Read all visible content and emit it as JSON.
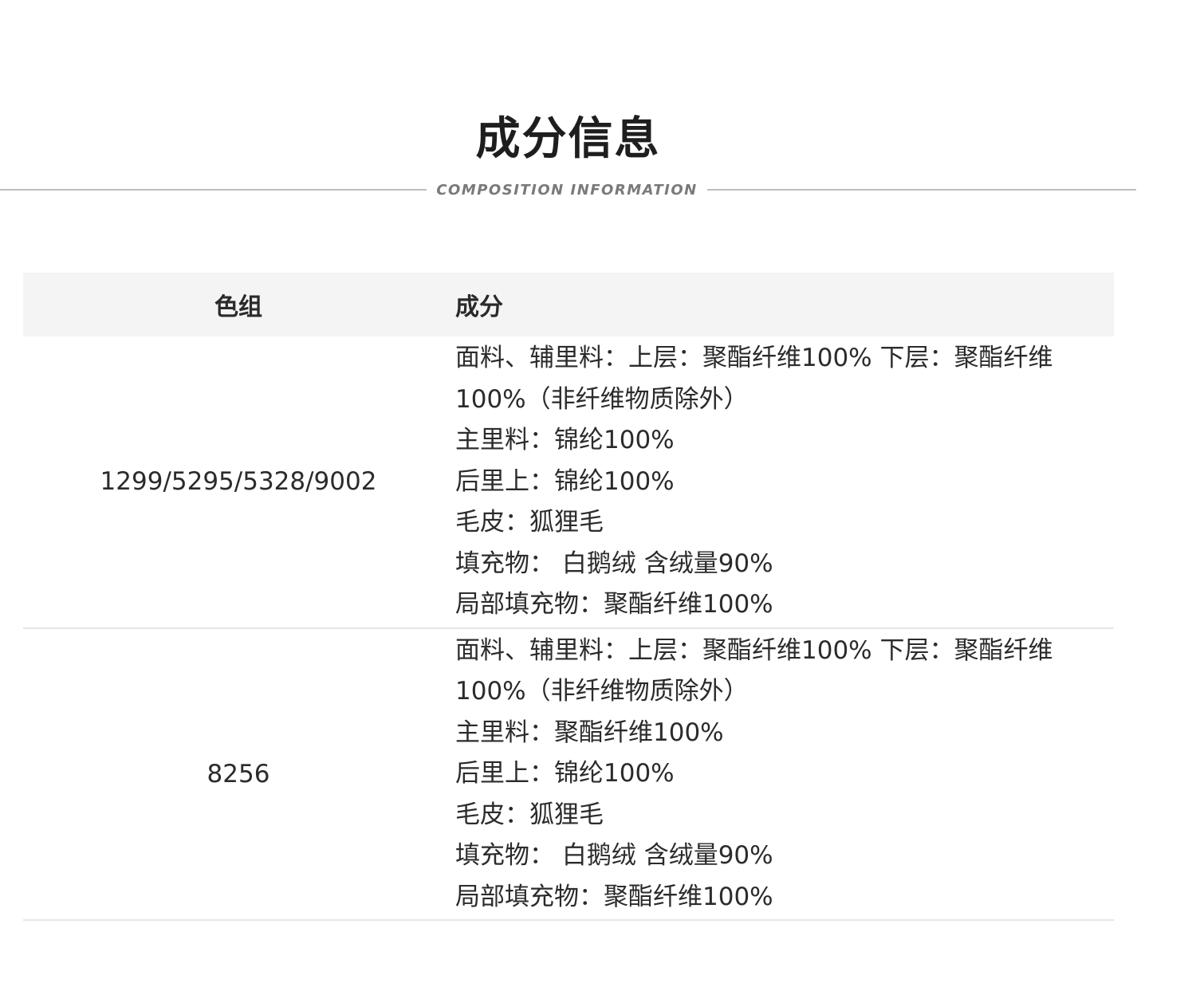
{
  "header": {
    "title": "成分信息",
    "subtitle": "COMPOSITION INFORMATION"
  },
  "table": {
    "headers": [
      "色组",
      "成分"
    ],
    "rows": [
      {
        "color_group": "1299/5295/5328/9002",
        "lines": [
          "面料、辅里料：上层：聚酯纤维100% 下层：聚酯纤维",
          "100%（非纤维物质除外）",
          "主里料：锦纶100%",
          "后里上：锦纶100%",
          "毛皮：狐狸毛",
          "填充物： 白鹅绒 含绒量90%",
          "局部填充物：聚酯纤维100%"
        ]
      },
      {
        "color_group": "8256",
        "lines": [
          "面料、辅里料：上层：聚酯纤维100% 下层：聚酯纤维",
          "100%（非纤维物质除外）",
          "主里料：聚酯纤维100%",
          "后里上：锦纶100%",
          "毛皮：狐狸毛",
          "填充物： 白鹅绒 含绒量90%",
          "局部填充物：聚酯纤维100%"
        ]
      }
    ]
  }
}
